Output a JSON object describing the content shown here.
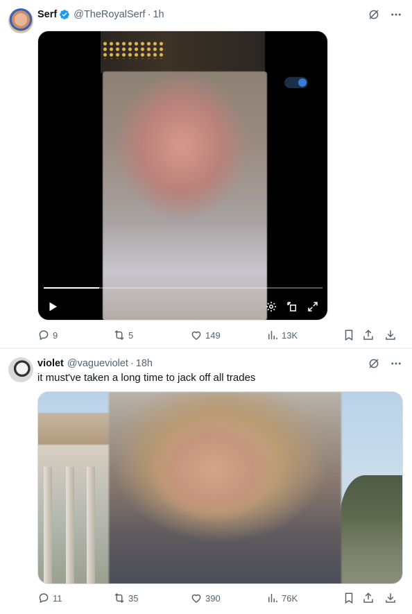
{
  "tweet1": {
    "name": "Serf",
    "handle": "@TheRoyalSerf",
    "separator": "·",
    "time": "1h",
    "video": {
      "progress_fraction": 0.2
    },
    "stats": {
      "replies": "9",
      "retweets": "5",
      "likes": "149",
      "views": "13K"
    }
  },
  "tweet2": {
    "name": "violet",
    "handle": "@vagueviolet",
    "separator": "·",
    "time": "18h",
    "text": "it must've taken a long time to jack off all trades",
    "stats": {
      "replies": "11",
      "retweets": "35",
      "likes": "390",
      "views": "76K"
    }
  },
  "icons": {
    "verified": "verified-badge-icon",
    "grok": "grok-icon",
    "more": "more-options-icon",
    "reply": "reply-icon",
    "retweet": "retweet-icon",
    "like": "heart-icon",
    "views": "views-chart-icon",
    "bookmark": "bookmark-icon",
    "share": "share-icon",
    "download": "download-icon",
    "play": "play-icon",
    "settings": "gear-icon",
    "pip": "picture-in-picture-icon",
    "fullscreen": "fullscreen-icon"
  },
  "colors": {
    "verified_blue": "#1d9bf0",
    "text_primary": "#0f1419",
    "text_secondary": "#536471"
  }
}
